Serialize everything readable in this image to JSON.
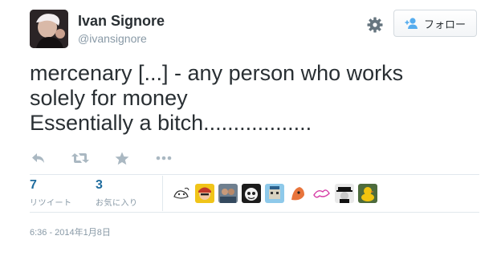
{
  "user": {
    "name": "Ivan Signore",
    "handle": "@ivansignore"
  },
  "follow_button": {
    "label": "フォロー"
  },
  "tweet": {
    "lines": [
      "mercenary [...] - any person who works",
      "solely for money",
      "Essentially a bitch.................."
    ]
  },
  "actions": [
    {
      "icon": "reply-icon"
    },
    {
      "icon": "retweet-icon"
    },
    {
      "icon": "favorite-star-icon"
    },
    {
      "icon": "more-dots-icon"
    }
  ],
  "stats": {
    "retweets": {
      "count": "7",
      "label": "リツイート"
    },
    "favorites": {
      "count": "3",
      "label": "お気に入り"
    }
  },
  "timestamp": "6:36 - 2014年1月8日",
  "colors": {
    "link_blue": "#1f6c9e",
    "muted": "#8899a6",
    "text": "#292f33",
    "border": "#e1e8ed"
  }
}
